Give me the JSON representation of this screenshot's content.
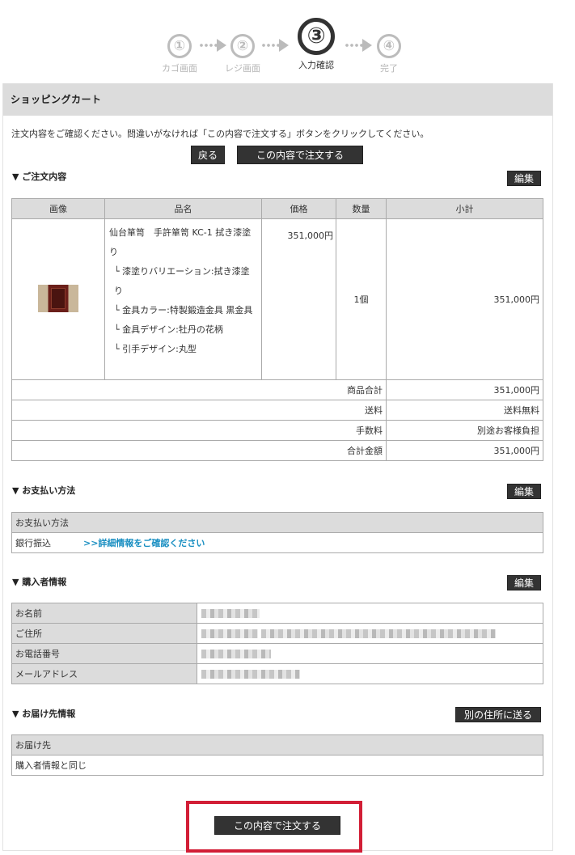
{
  "steps": [
    {
      "num": "①",
      "label": "カゴ画面",
      "active": false
    },
    {
      "num": "②",
      "label": "レジ画面",
      "active": false
    },
    {
      "num": "③",
      "label": "入力確認",
      "active": true
    },
    {
      "num": "④",
      "label": "完了",
      "active": false
    }
  ],
  "panel": {
    "title": "ショッピングカート",
    "notice": "注文内容をご確認ください。問違いがなければ「この内容で注文する」ボタンをクリックしてください。",
    "back_label": "戻る",
    "order_label": "この内容で注文する"
  },
  "order": {
    "section_title": "▼ ご注文内容",
    "edit_label": "編集",
    "headers": [
      "画像",
      "品名",
      "価格",
      "数量",
      "小計"
    ],
    "item": {
      "name": "仙台箪笥　手許箪笥 KC-1 拭き漆塗り",
      "options": [
        "└ 漆塗りバリエーション:拭き漆塗り",
        "└ 金具カラー:特製鍛造金具 黒金具",
        "└ 金具デザイン:牡丹の花柄",
        "└ 引手デザイン:丸型"
      ],
      "price": "351,000円",
      "qty": "1個",
      "subtotal": "351,000円"
    },
    "summary": [
      {
        "label": "商品合計",
        "value": "351,000円"
      },
      {
        "label": "送料",
        "value": "送料無料"
      },
      {
        "label": "手数料",
        "value": "別途お客様負担"
      },
      {
        "label": "合計金額",
        "value": "351,000円"
      }
    ]
  },
  "payment": {
    "section_title": "▼ お支払い方法",
    "edit_label": "編集",
    "header": "お支払い方法",
    "method": "銀行振込",
    "link": ">>詳細情報をご確認ください"
  },
  "buyer": {
    "section_title": "▼ 購入者情報",
    "edit_label": "編集",
    "rows": [
      "お名前",
      "ご住所",
      "お電話番号",
      "メールアドレス"
    ]
  },
  "delivery": {
    "section_title": "▼ お届け先情報",
    "alt_label": "別の住所に送る",
    "header": "お届け先",
    "value": "購入者情報と同じ"
  },
  "bottom": {
    "order_label": "この内容で注文する"
  },
  "colors": {
    "button_bg": "#333333",
    "highlight": "#d21e36",
    "link": "#1a8fc2"
  }
}
